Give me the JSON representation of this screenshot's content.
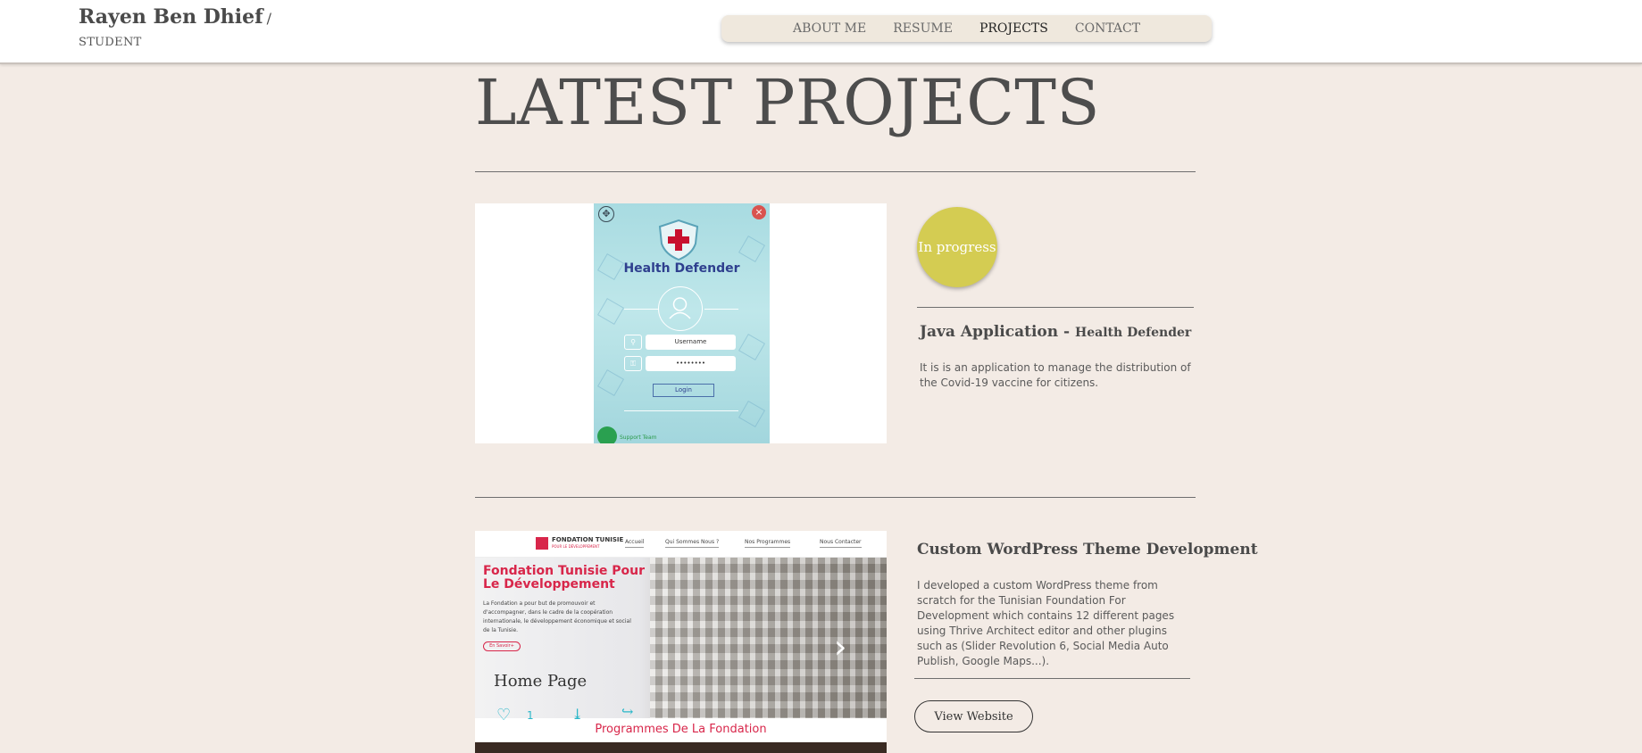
{
  "header": {
    "name": "Rayen Ben Dhief",
    "separator": "/",
    "role": "STUDENT",
    "nav": [
      {
        "label": "ABOUT ME"
      },
      {
        "label": "RESUME"
      },
      {
        "label": "PROJECTS",
        "active": true
      },
      {
        "label": "CONTACT"
      }
    ]
  },
  "page_title": "LATEST PROJECTS",
  "projects": [
    {
      "status": "In progress",
      "title": "Java Application -",
      "subtitle": "Health Defender",
      "description": "It is is an application to manage the distribution of the Covid-19 vaccine for citizens.",
      "screenshot": {
        "app_name": "Health Defender",
        "username": "Username",
        "password": "••••••••",
        "login": "Login",
        "support": "Support Team",
        "move_icon": "✥",
        "close_icon": "×"
      }
    },
    {
      "title": "Custom WordPress Theme Development",
      "description": "I developed a custom WordPress theme from scratch for the Tunisian Foundation For Development which contains 12 different pages using Thrive Architect editor and other plugins such as (Slider Revolution 6, Social Media Auto Publish, Google Maps...).",
      "button": "View Website",
      "screenshot": {
        "logo_text": "FONDATION TUNISIE",
        "logo_sub": "POUR LE DÉVELOPPEMENT",
        "menu": [
          "Accueil",
          "Qui Sommes Nous ?",
          "Nos Programmes",
          "Nous Contacter"
        ],
        "heading": "Fondation Tunisie Pour Le Développement",
        "paragraph": "La Fondation a pour but de promouvoir et d'accompagner, dans le cadre de la coopération internationale, le développement économique et social de la Tunisie.",
        "cta": "En Savoir+",
        "caption": "Home Page",
        "likes": "1",
        "section": "Programmes De La Fondation",
        "heart_icon": "♡",
        "download_icon": "⤓",
        "share_icon": "↪",
        "next_icon": "›"
      }
    }
  ],
  "colors": {
    "background": "#f3ebe5",
    "badge": "#d4cc52",
    "accent_red": "#d8264a",
    "nav_bg": "#efe8dd"
  }
}
